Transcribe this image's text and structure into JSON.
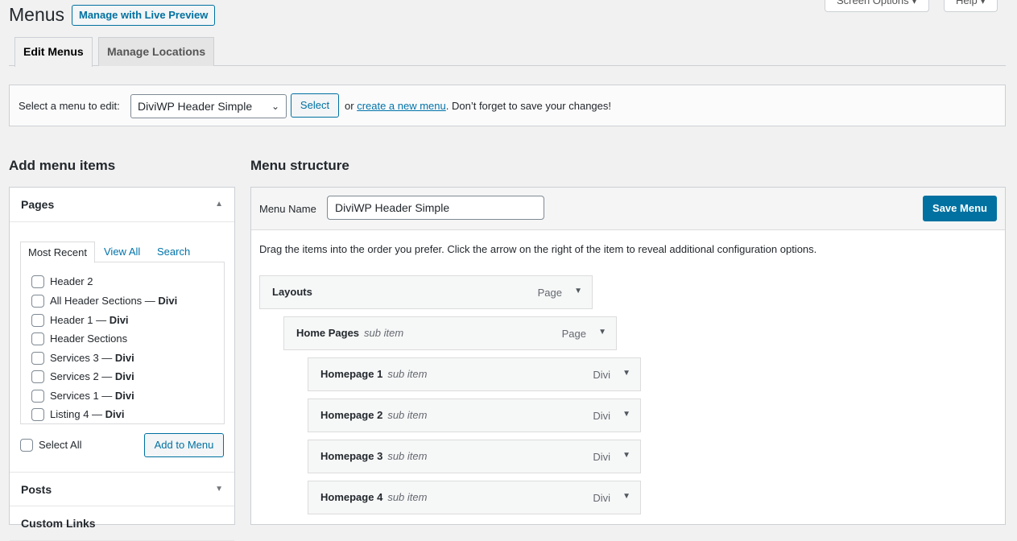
{
  "header": {
    "title": "Menus",
    "live_preview_label": "Manage with Live Preview",
    "screen_options_label": "Screen Options ▾",
    "help_label": "Help ▾"
  },
  "nav_tabs": [
    {
      "label": "Edit Menus",
      "active": true
    },
    {
      "label": "Manage Locations",
      "active": false
    }
  ],
  "manage_bar": {
    "label": "Select a menu to edit:",
    "selected_menu": "DiviWP Header Simple",
    "select_label": "Select",
    "msg_prefix": "or",
    "create_link": "create a new menu",
    "msg_suffix": ". Don’t forget to save your changes!"
  },
  "add_items": {
    "heading": "Add menu items",
    "pages_title": "Pages",
    "tabs": [
      "Most Recent",
      "View All",
      "Search"
    ],
    "pages": [
      {
        "name": "Header 2",
        "suffix": ""
      },
      {
        "name": "All Header Sections — ",
        "suffix": "Divi"
      },
      {
        "name": "Header 1 — ",
        "suffix": "Divi"
      },
      {
        "name": "Header Sections",
        "suffix": ""
      },
      {
        "name": "Services 3 — ",
        "suffix": "Divi"
      },
      {
        "name": "Services 2 — ",
        "suffix": "Divi"
      },
      {
        "name": "Services 1 — ",
        "suffix": "Divi"
      },
      {
        "name": "Listing 4 — ",
        "suffix": "Divi"
      }
    ],
    "select_all_label": "Select All",
    "add_to_menu_label": "Add to Menu",
    "posts_title": "Posts",
    "custom_links_title": "Custom Links"
  },
  "structure": {
    "heading": "Menu structure",
    "menu_name_label": "Menu Name",
    "menu_name_value": "DiviWP Header Simple",
    "save_label": "Save Menu",
    "instructions": "Drag the items into the order you prefer. Click the arrow on the right of the item to reveal additional configuration options.",
    "items": [
      {
        "title": "Layouts",
        "sub": "",
        "type": "Page",
        "depth": 0
      },
      {
        "title": "Home Pages",
        "sub": "sub item",
        "type": "Page",
        "depth": 1
      },
      {
        "title": "Homepage 1",
        "sub": "sub item",
        "type": "Divi",
        "depth": 2
      },
      {
        "title": "Homepage 2",
        "sub": "sub item",
        "type": "Divi",
        "depth": 2
      },
      {
        "title": "Homepage 3",
        "sub": "sub item",
        "type": "Divi",
        "depth": 2
      },
      {
        "title": "Homepage 4",
        "sub": "sub item",
        "type": "Divi",
        "depth": 2
      }
    ]
  }
}
